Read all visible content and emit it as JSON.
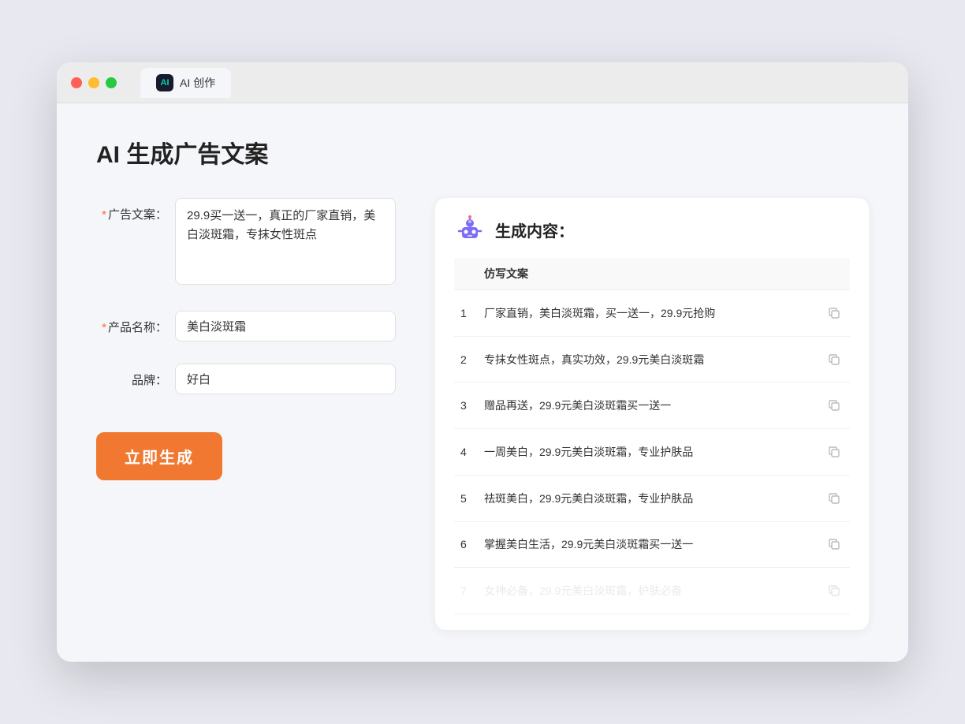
{
  "browser": {
    "tab_label": "AI 创作",
    "tab_icon_text": "AI"
  },
  "page": {
    "title": "AI 生成广告文案"
  },
  "form": {
    "ad_copy_label": "广告文案：",
    "ad_copy_required": "*",
    "ad_copy_value": "29.9买一送一，真正的厂家直销，美白淡斑霜，专抹女性斑点",
    "product_name_label": "产品名称：",
    "product_name_required": "*",
    "product_name_value": "美白淡斑霜",
    "brand_label": "品牌：",
    "brand_value": "好白",
    "generate_btn": "立即生成"
  },
  "result": {
    "header_title": "生成内容：",
    "table_header": "仿写文案",
    "items": [
      {
        "num": 1,
        "text": "厂家直销，美白淡斑霜，买一送一，29.9元抢购"
      },
      {
        "num": 2,
        "text": "专抹女性斑点，真实功效，29.9元美白淡斑霜"
      },
      {
        "num": 3,
        "text": "赠品再送，29.9元美白淡斑霜买一送一"
      },
      {
        "num": 4,
        "text": "一周美白，29.9元美白淡斑霜，专业护肤品"
      },
      {
        "num": 5,
        "text": "祛斑美白，29.9元美白淡斑霜，专业护肤品"
      },
      {
        "num": 6,
        "text": "掌握美白生活，29.9元美白淡斑霜买一送一"
      },
      {
        "num": 7,
        "text": "女神必备，29.9元美白淡斑霜，护肤必备",
        "faded": true
      }
    ]
  }
}
